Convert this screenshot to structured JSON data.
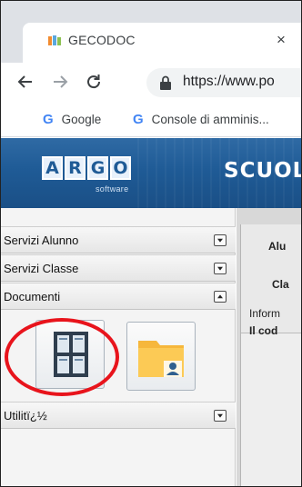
{
  "browser": {
    "tab": {
      "title": "GECODOC",
      "close_glyph": "×"
    },
    "nav": {
      "back_glyph": "←",
      "forward_glyph": "→",
      "reload_glyph": "C"
    },
    "url": "https://www.po",
    "bookmarks": [
      {
        "icon": "G",
        "label": "Google"
      },
      {
        "icon": "G",
        "label": "Console di amminis..."
      }
    ]
  },
  "header": {
    "logo_letters": [
      "A",
      "R",
      "G",
      "O"
    ],
    "logo_subtitle": "software",
    "title": "SCUOLA",
    "colors": {
      "background": "#1f5b96"
    }
  },
  "sidebar": {
    "sections": [
      {
        "label": "Servizi Alunno",
        "state": "collapsed"
      },
      {
        "label": "Servizi Classe",
        "state": "collapsed"
      },
      {
        "label": "Documenti",
        "state": "expanded"
      },
      {
        "label": "Utilitï¿½",
        "state": "collapsed"
      }
    ],
    "documenti_icons": [
      "grid-document-icon",
      "user-folder-icon"
    ]
  },
  "content": {
    "line1": "Alu",
    "line2": "Cla",
    "line3": "Inform",
    "line4": "Il cod"
  },
  "annotation": {
    "color": "#e8141c"
  }
}
